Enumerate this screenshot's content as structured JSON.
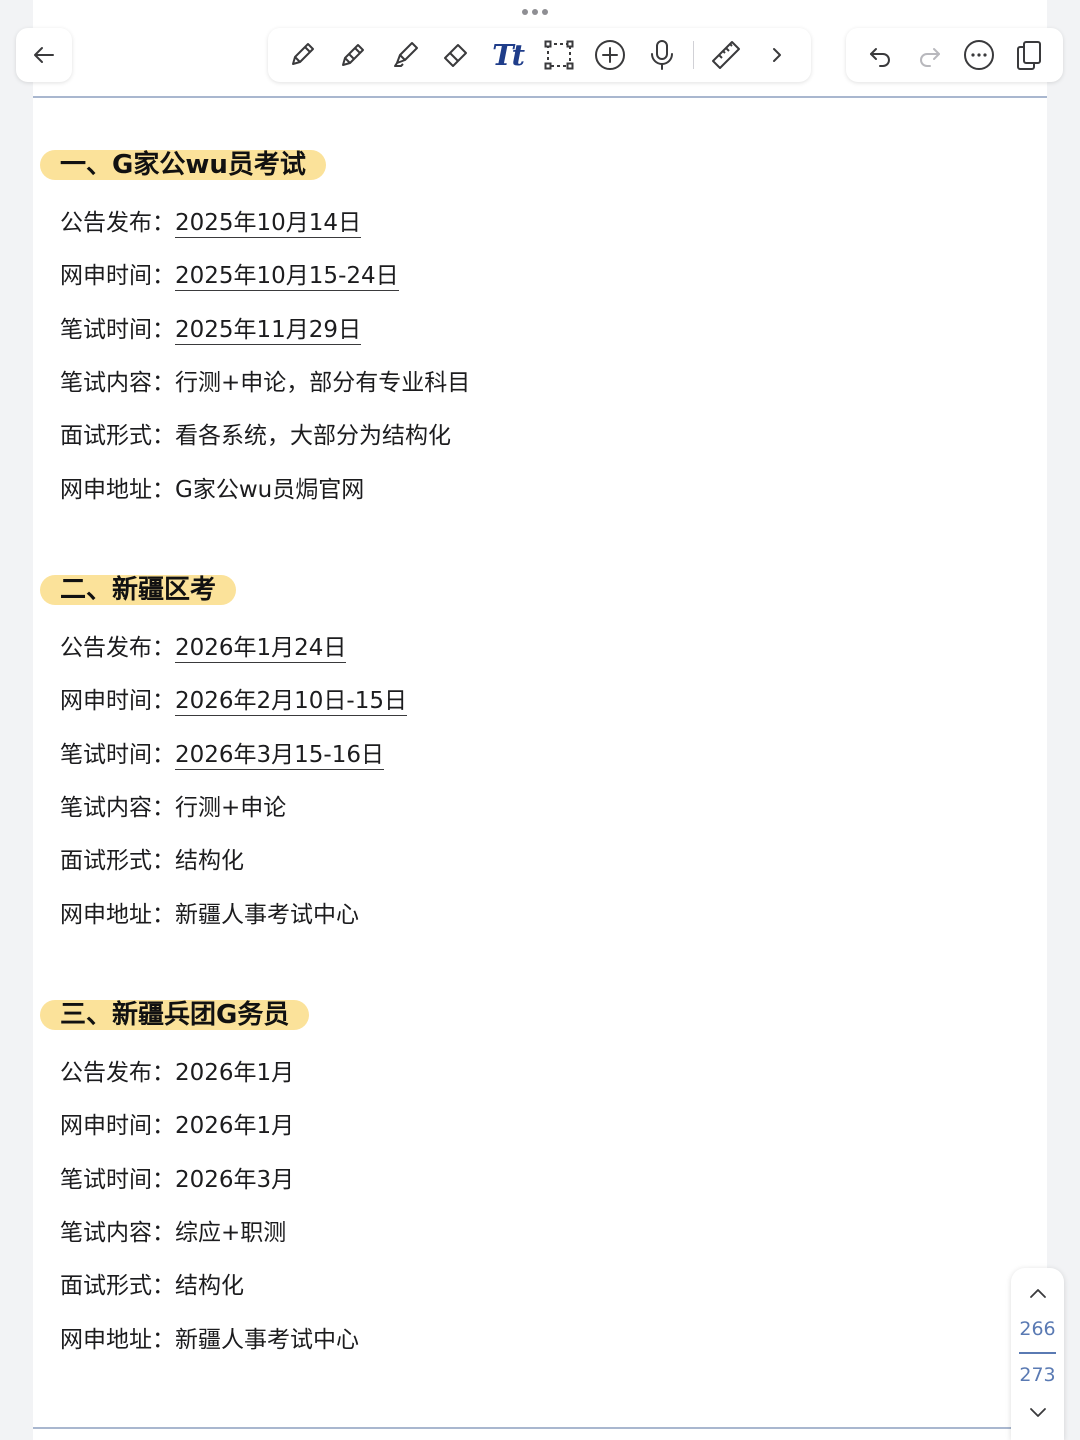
{
  "toolbar": {
    "tools": [
      "pen-icon",
      "pencil-icon",
      "highlighter-icon",
      "eraser-icon",
      "text-tool-icon",
      "lasso-select-icon",
      "add-icon",
      "microphone-icon",
      "ruler-icon",
      "chevron-right-icon"
    ],
    "text_tool_glyph": "Tt",
    "right_tools": [
      "undo-icon",
      "redo-icon",
      "more-icon",
      "pages-icon"
    ]
  },
  "sections": [
    {
      "heading": "一、G家公wu员考试",
      "rows": [
        {
          "label": "公告发布：",
          "value": "2025年10月14日",
          "underlined": true
        },
        {
          "label": "网申时间：",
          "value": "2025年10月15-24日",
          "underlined": true
        },
        {
          "label": "笔试时间：",
          "value": "2025年11月29日",
          "underlined": true
        },
        {
          "label": "笔试内容：",
          "value": "行测+申论，部分有专业科目",
          "underlined": false
        },
        {
          "label": "面试形式：",
          "value": "看各系统，大部分为结构化",
          "underlined": false
        },
        {
          "label": "网申地址：",
          "value": "G家公wu员焗官网",
          "underlined": false
        }
      ]
    },
    {
      "heading": "二、新疆区考",
      "rows": [
        {
          "label": "公告发布：",
          "value": "2026年1月24日",
          "underlined": true
        },
        {
          "label": "网申时间：",
          "value": "2026年2月10日-15日",
          "underlined": true
        },
        {
          "label": "笔试时间：",
          "value": "2026年3月15-16日",
          "underlined": true
        },
        {
          "label": "笔试内容：",
          "value": "行测+申论",
          "underlined": false
        },
        {
          "label": "面试形式：",
          "value": "结构化",
          "underlined": false
        },
        {
          "label": "网申地址：",
          "value": "新疆人事考试中心",
          "underlined": false
        }
      ]
    },
    {
      "heading": "三、新疆兵团G务员",
      "rows": [
        {
          "label": "公告发布：",
          "value": "2026年1月",
          "underlined": false
        },
        {
          "label": "网申时间：",
          "value": "2026年1月",
          "underlined": false
        },
        {
          "label": "笔试时间：",
          "value": "2026年3月",
          "underlined": false
        },
        {
          "label": "笔试内容：",
          "value": "综应+职测",
          "underlined": false
        },
        {
          "label": "面试形式：",
          "value": "结构化",
          "underlined": false
        },
        {
          "label": "网申地址：",
          "value": "新疆人事考试中心",
          "underlined": false
        }
      ]
    }
  ],
  "pager": {
    "current": "266",
    "total": "273"
  },
  "colors": {
    "heading_highlight": "#fbe29a",
    "rule": "#a9b7cf",
    "pager_text": "#5a7ab3",
    "text_tool": "#1f3d8a"
  }
}
